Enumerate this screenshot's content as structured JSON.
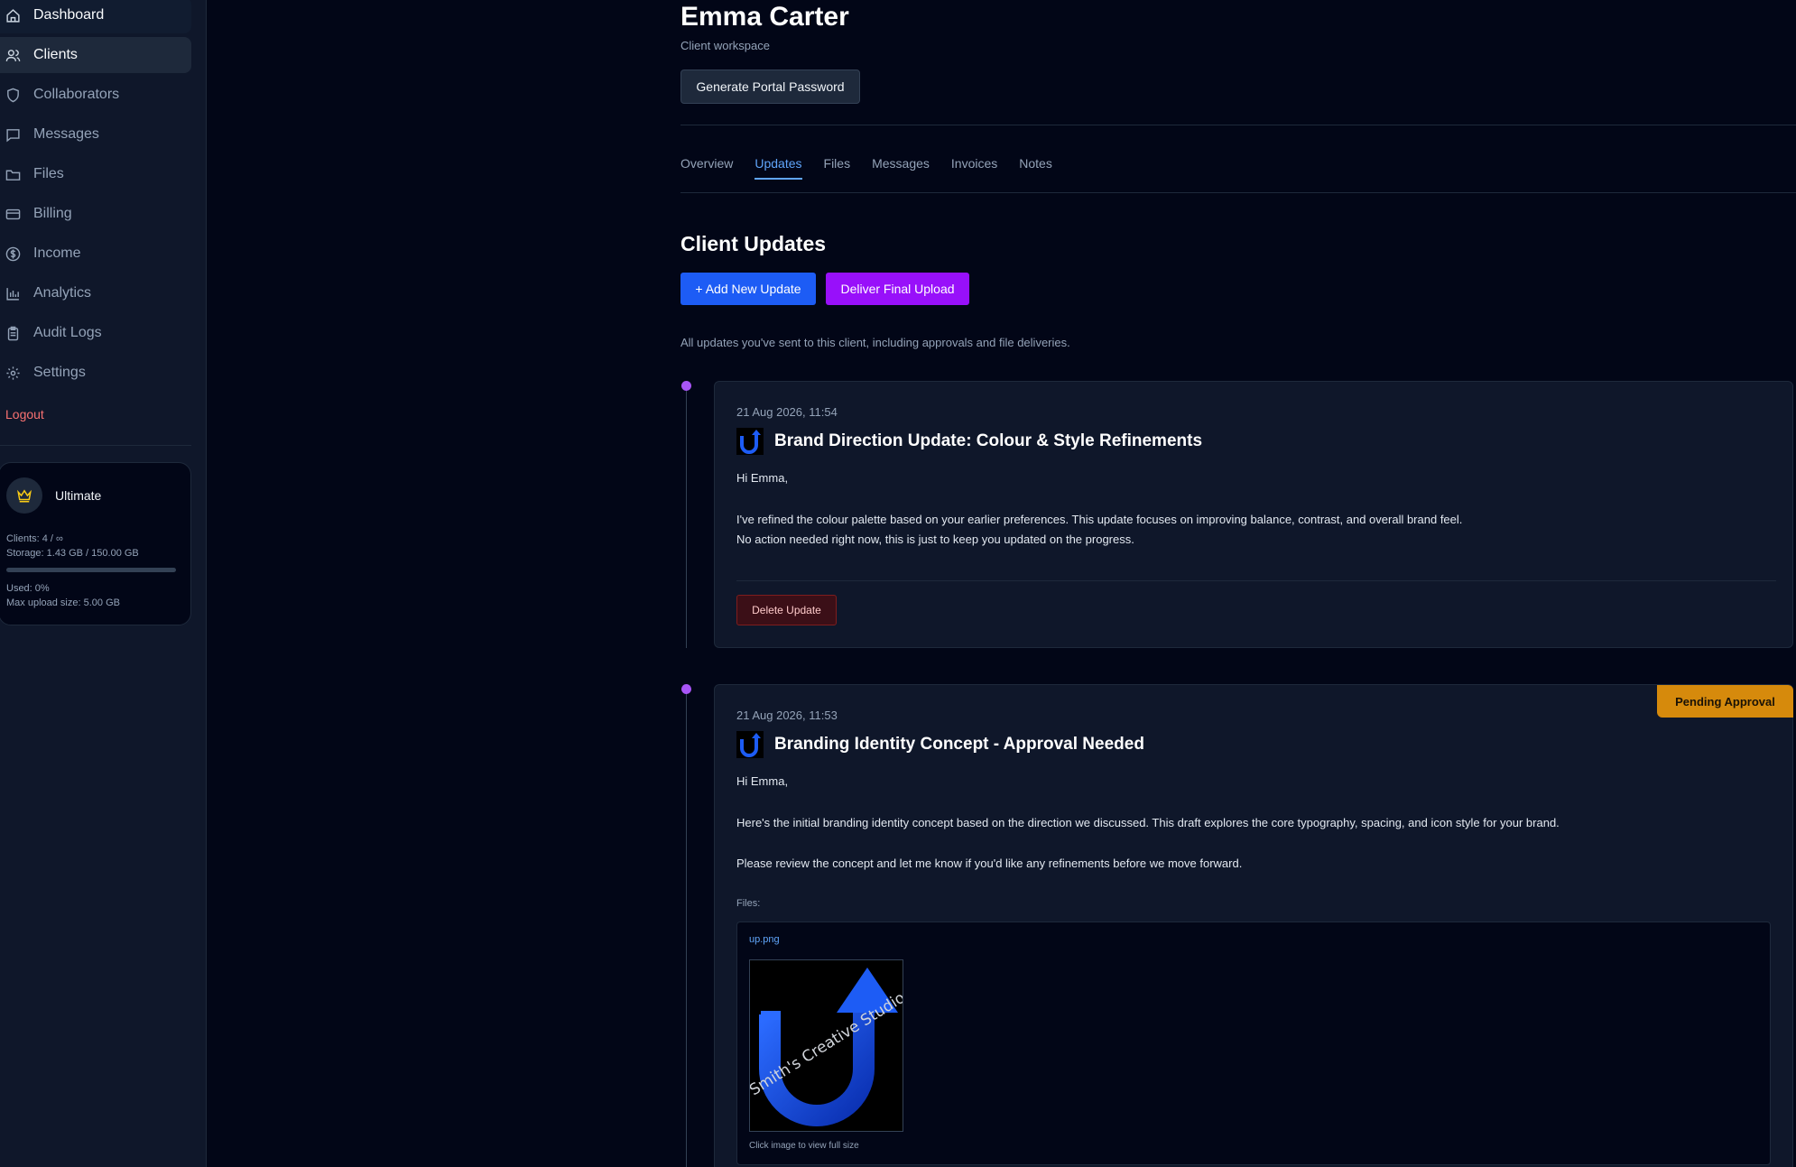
{
  "sidebar": {
    "items": [
      {
        "label": "Dashboard",
        "icon": "home-icon"
      },
      {
        "label": "Clients",
        "icon": "users-icon"
      },
      {
        "label": "Collaborators",
        "icon": "shield-icon"
      },
      {
        "label": "Messages",
        "icon": "message-icon"
      },
      {
        "label": "Files",
        "icon": "folder-icon"
      },
      {
        "label": "Billing",
        "icon": "credit-card-icon"
      },
      {
        "label": "Income",
        "icon": "dollar-icon"
      },
      {
        "label": "Analytics",
        "icon": "bar-chart-icon"
      },
      {
        "label": "Audit Logs",
        "icon": "clipboard-icon"
      },
      {
        "label": "Settings",
        "icon": "gear-icon"
      }
    ],
    "active": "Clients",
    "logout": "Logout",
    "plan": {
      "name": "Ultimate",
      "clients": "Clients: 4 / ∞",
      "storage": "Storage: 1.43 GB / 150.00 GB",
      "used": "Used: 0%",
      "max_upload": "Max upload size: 5.00 GB",
      "used_fraction": 0
    }
  },
  "header": {
    "title": "Emma Carter",
    "subtitle": "Client workspace",
    "portal_button": "Generate Portal Password"
  },
  "tabs": [
    "Overview",
    "Updates",
    "Files",
    "Messages",
    "Invoices",
    "Notes"
  ],
  "active_tab": "Updates",
  "section": {
    "title": "Client Updates",
    "add_button": "+ Add New Update",
    "deliver_button": "Deliver Final Upload",
    "intro": "All updates you've sent to this client, including approvals and file deliveries."
  },
  "updates": [
    {
      "date": "21 Aug 2026, 11:54",
      "title": "Brand Direction Update: Colour & Style Refinements",
      "greeting": "Hi Emma,",
      "body1": "I've refined the colour palette based on your earlier preferences. This update focuses on improving balance, contrast, and overall brand feel.",
      "body2": "No action needed right now, this is just to keep you updated on the progress.",
      "delete_button": "Delete Update"
    },
    {
      "date": "21 Aug 2026, 11:53",
      "title": "Branding Identity Concept - Approval Needed",
      "badge": "Pending Approval",
      "greeting": "Hi Emma,",
      "body1": "Here's the initial branding identity concept based on the direction we discussed. This draft explores the core typography, spacing, and icon style for your brand.",
      "body2": "Please review the concept and let me know if you'd like any refinements before we move forward.",
      "files_label": "Files:",
      "file_name": "up.png",
      "image_watermark": "Smith's Creative Studio",
      "caption": "Click image to view full size"
    }
  ],
  "colors": {
    "accent_blue": "#1d5cf5",
    "accent_purple": "#9810fa",
    "badge_amber": "#d68a0c",
    "danger": "#f87171"
  }
}
